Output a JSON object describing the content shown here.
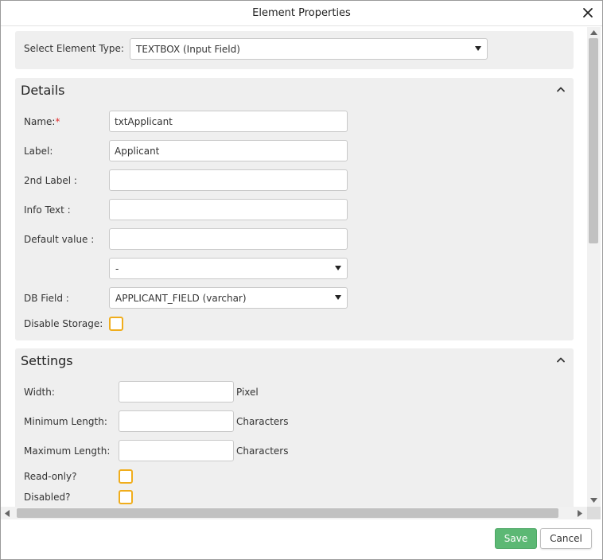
{
  "dialog": {
    "title": "Element Properties"
  },
  "element_type": {
    "label": "Select Element Type:",
    "selected": "TEXTBOX (Input Field)"
  },
  "details": {
    "heading": "Details",
    "name_label": "Name:",
    "name_required_marker": "*",
    "name_value": "txtApplicant",
    "label_label": "Label:",
    "label_value": "Applicant",
    "second_label_label": "2nd Label :",
    "second_label_value": "",
    "info_text_label": "Info Text :",
    "info_text_value": "",
    "default_value_label": "Default value :",
    "default_value_value": "",
    "default_source_selected": "-",
    "db_field_label": "DB Field :",
    "db_field_selected": "APPLICANT_FIELD (varchar)",
    "disable_storage_label": "Disable Storage:",
    "disable_storage_checked": false
  },
  "settings": {
    "heading": "Settings",
    "width_label": "Width:",
    "width_value": "",
    "width_unit": "Pixel",
    "min_length_label": "Minimum Length:",
    "min_length_value": "",
    "min_length_unit": "Characters",
    "max_length_label": "Maximum Length:",
    "max_length_value": "",
    "max_length_unit": "Characters",
    "readonly_label": "Read-only?",
    "readonly_checked": false,
    "disabled_label": "Disabled?",
    "disabled_checked": false
  },
  "footer": {
    "save_label": "Save",
    "cancel_label": "Cancel"
  },
  "colors": {
    "accent_checkbox": "#f0ad1c",
    "save_button": "#5cb874",
    "required_marker": "#e03030",
    "panel_background": "#efefef"
  },
  "icons": {
    "close": "close-icon",
    "collapse": "chevron-up-icon",
    "dropdown": "caret-down-icon"
  }
}
